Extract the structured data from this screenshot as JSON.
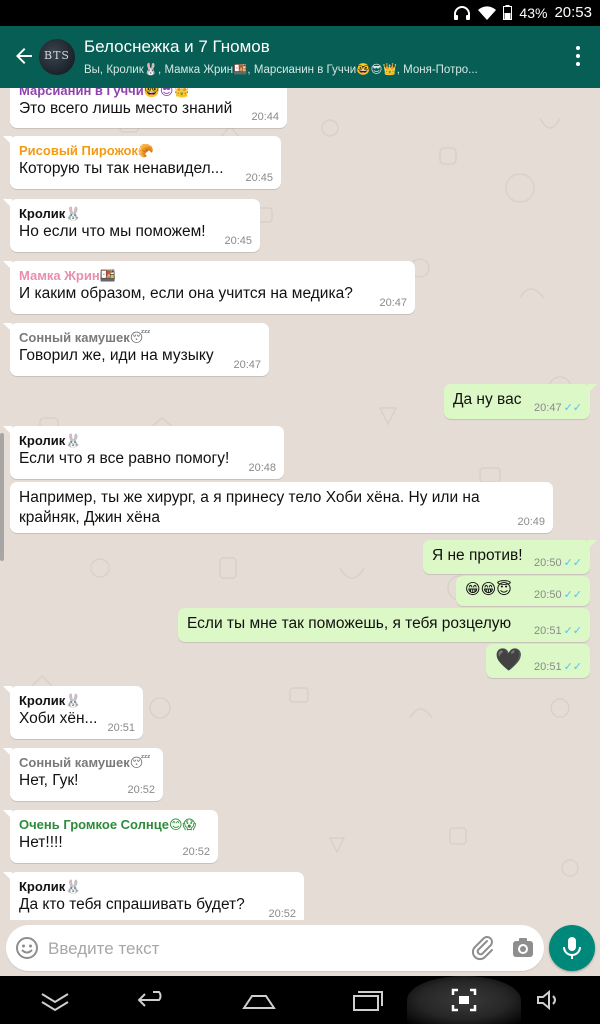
{
  "status_bar": {
    "battery": "43%",
    "time": "20:53"
  },
  "header": {
    "avatar_text": "BTS",
    "title": "Белоснежка и 7 Гномов",
    "subtitle": "Вы, Кролик🐰, Мамка Жрин🍱, Марсианин в Гуччи🤓😎👑, Моня-Потро..."
  },
  "messages": [
    {
      "dir": "in",
      "sender": "Марсианин в Гуччи🤓😎👑",
      "sender_color": "#8e44ad",
      "text": "Это всего лишь место знаний",
      "time": "20:44"
    },
    {
      "dir": "in",
      "sender": "Рисовый Пирожок🥐",
      "sender_color": "#f39c12",
      "text": "Которую ты так ненавидел...",
      "time": "20:45"
    },
    {
      "dir": "in",
      "sender": "Кролик🐰",
      "sender_color": "#111111",
      "text": "Но если что мы поможем!",
      "time": "20:45"
    },
    {
      "dir": "in",
      "sender": "Мамка Жрин🍱",
      "sender_color": "#e88fb0",
      "text": "И каким образом, если она учится на медика?",
      "time": "20:47"
    },
    {
      "dir": "in",
      "sender": "Сонный камушек😴",
      "sender_color": "#7a7a7a",
      "text": "Говорил же, иди на музыку",
      "time": "20:47"
    },
    {
      "dir": "out",
      "text": "Да ну вас",
      "time": "20:47",
      "ticks": "✓✓"
    },
    {
      "dir": "in",
      "sender": "Кролик🐰",
      "sender_color": "#111111",
      "text": "Если что я все равно помогу!",
      "time": "20:48"
    },
    {
      "dir": "in",
      "text": "Например, ты же хирург, а я принесу тело Хоби хёна. Ну или на крайняк, Джин хёна",
      "time": "20:49"
    },
    {
      "dir": "out",
      "text": "Я не против!",
      "time": "20:50",
      "ticks": "✓✓"
    },
    {
      "dir": "out",
      "text": "😁😁😇",
      "time": "20:50",
      "ticks": "✓✓"
    },
    {
      "dir": "out",
      "text": "Если ты мне так поможешь, я тебя розцелую",
      "time": "20:51",
      "ticks": "✓✓"
    },
    {
      "dir": "out",
      "text": "🖤",
      "time": "20:51",
      "ticks": "✓✓"
    },
    {
      "dir": "in",
      "sender": "Кролик🐰",
      "sender_color": "#111111",
      "text": "Хоби хён...",
      "time": "20:51"
    },
    {
      "dir": "in",
      "sender": "Сонный камушек😴",
      "sender_color": "#7a7a7a",
      "text": "Нет, Гук!",
      "time": "20:52"
    },
    {
      "dir": "in",
      "sender": "Очень Громкое Солнце😊😱",
      "sender_color": "#2e8b3a",
      "text": "Нет!!!!",
      "time": "20:52"
    },
    {
      "dir": "in",
      "sender": "Кролик🐰",
      "sender_color": "#111111",
      "text": "Да кто тебя спрашивать будет?",
      "time": "20:52"
    }
  ],
  "input": {
    "placeholder": "Введите текст"
  },
  "icons": {
    "back": "arrow-left-icon",
    "menu": "more-vert-icon",
    "emoji": "smile-icon",
    "attach": "paperclip-icon",
    "camera": "camera-icon",
    "mic": "microphone-icon",
    "nav": [
      "chevron-down-icon",
      "back-icon",
      "home-icon",
      "recents-icon",
      "screenshot-icon",
      "volume-icon"
    ]
  },
  "colors": {
    "header": "#075e54",
    "outgoing": "#dcf8c6",
    "incoming": "#ffffff",
    "ticks": "#4fc3f7",
    "mic": "#00897b",
    "chat_bg": "#e5ddd5"
  }
}
